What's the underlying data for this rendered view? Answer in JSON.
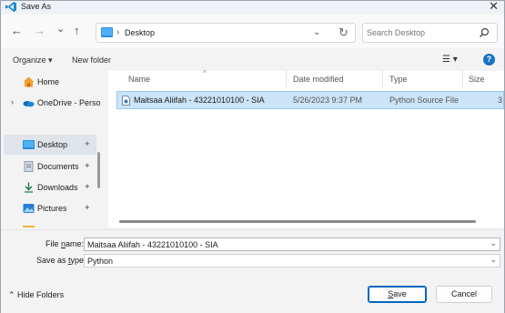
{
  "window": {
    "title": "Save As",
    "icon": "vscode-icon"
  },
  "nav": {
    "back": "←",
    "forward": "→",
    "recent": "⌄",
    "up": "↑",
    "address": {
      "location": "Desktop",
      "separator": "›"
    },
    "search_placeholder": "Search Desktop"
  },
  "cmdbar": {
    "organize": "Organize ▾",
    "new_folder": "New folder"
  },
  "sidebar": {
    "items": [
      {
        "label": "Home",
        "icon": "home-icon"
      },
      {
        "label": "OneDrive - Perso",
        "icon": "onedrive-icon"
      },
      {
        "label": "Desktop",
        "icon": "desktop-icon",
        "pin": "★"
      },
      {
        "label": "Documents",
        "icon": "documents-icon",
        "pin": "★"
      },
      {
        "label": "Downloads",
        "icon": "downloads-icon",
        "pin": "★"
      },
      {
        "label": "Pictures",
        "icon": "pictures-icon",
        "pin": "★"
      }
    ]
  },
  "columns": {
    "name": "Name",
    "date": "Date modified",
    "type": "Type",
    "size": "Size"
  },
  "files": [
    {
      "name": "Maitsaa Aliifah - 43221010100 - SIA",
      "date": "5/26/2023 9:37 PM",
      "type": "Python Source File",
      "size": "3"
    }
  ],
  "form": {
    "file_name_label_pre": "File ",
    "file_name_label_ul": "n",
    "file_name_label_post": "ame:",
    "file_name_value": "Maitsaa Aliifah - 43221010100 - SIA",
    "save_type_label_pre": "Save as ",
    "save_type_label_ul": "t",
    "save_type_label_post": "ype:",
    "save_type_value": "Python",
    "hide_folders": "Hide Folders",
    "save_ul": "S",
    "save_rest": "ave",
    "cancel": "Cancel"
  },
  "colors": {
    "accent": "#0067c0",
    "selection": "#cce4f7"
  }
}
